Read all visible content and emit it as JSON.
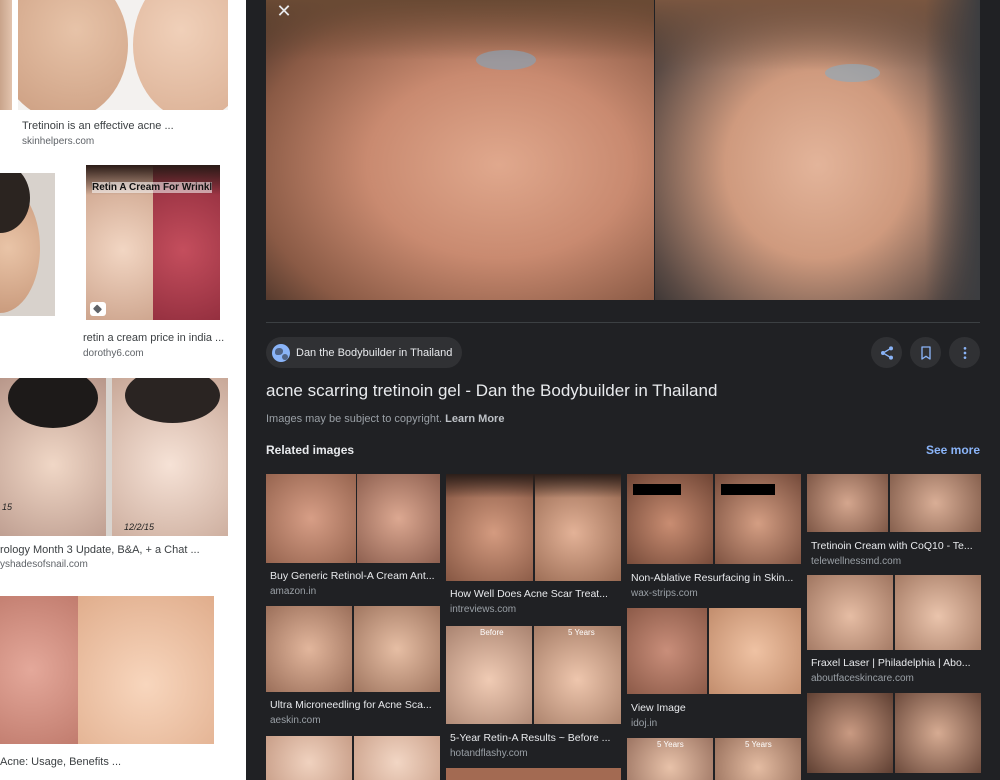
{
  "left_results": [
    {
      "caption": "Tretinoin is an effective acne ...",
      "source": "skinhelpers.com"
    },
    {
      "caption": "retin a cream price in india ...",
      "source": "dorothy6.com",
      "image_text": "Retin A Cream For Wrinkl"
    },
    {
      "caption": "rology Month 3 Update, B&A, + a Chat ...",
      "source": "yshadesofsnail.com",
      "image_text": "12/2/15",
      "image_text_left": "15"
    },
    {
      "caption": "Acne: Usage, Benefits ...",
      "source": ""
    }
  ],
  "panel": {
    "close_icon": "✕",
    "source_name": "Dan the Bodybuilder in Thailand",
    "title": "acne scarring tretinoin gel - Dan the Bodybuilder in Thailand",
    "copyright_text": "Images may be subject to copyright.",
    "learn_more": "Learn More",
    "related_heading": "Related images",
    "see_more": "See more"
  },
  "related": [
    {
      "caption": "Buy Generic Retinol-A Cream Ant...",
      "source": "amazon.in"
    },
    {
      "caption": "Ultra Microneedling for Acne Sca...",
      "source": "aeskin.com"
    },
    {
      "caption": "How Well Does Acne Scar Treat...",
      "source": "intreviews.com"
    },
    {
      "caption": "5-Year Retin-A Results ~ Before ...",
      "source": "hotandflashy.com",
      "label_left": "Before",
      "label_right": "5 Years"
    },
    {
      "caption": "Non-Ablative Resurfacing in Skin...",
      "source": "wax-strips.com"
    },
    {
      "caption": "View Image",
      "source": "idoj.in"
    },
    {
      "caption": "",
      "source": "",
      "label_left": "5 Years",
      "label_right": "5 Years"
    },
    {
      "caption": "Tretinoin Cream with CoQ10 - Te...",
      "source": "telewellnessmd.com"
    },
    {
      "caption": "Fraxel Laser | Philadelphia | Abo...",
      "source": "aboutfaceskincare.com"
    }
  ],
  "colors": {
    "panel_bg": "#202124",
    "chip_bg": "#303134",
    "link_blue": "#8ab4f8",
    "text_primary": "#e8eaed",
    "text_secondary": "#9aa0a6"
  },
  "icons": {
    "share": "share-icon",
    "bookmark": "bookmark-icon",
    "more": "more-vert-icon",
    "globe": "globe-icon",
    "close": "close-icon",
    "tag": "tag-icon"
  }
}
